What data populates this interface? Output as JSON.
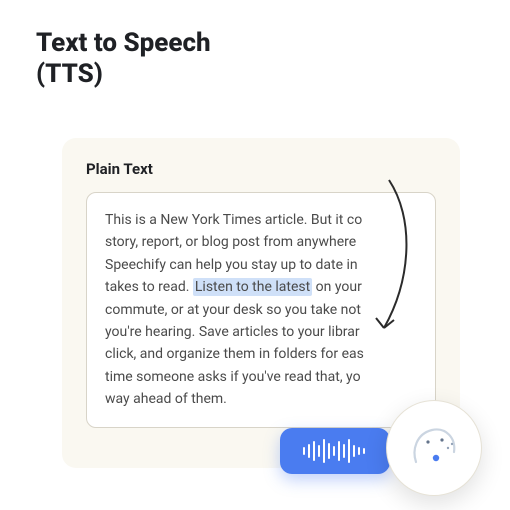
{
  "title_line1": "Text to Speech",
  "title_line2": "(TTS)",
  "card": {
    "label": "Plain Text",
    "body_before": "This is a New York Times article. But it co\nstory, report, or blog post from anywhere\nSpeechify can help you stay up to date in\ntakes to read. ",
    "highlight": "Listen to the latest",
    "body_after": " on your\ncommute, or at your desk so you take not\nyou're hearing. Save articles to your librar\nclick, and organize them in folders for eas\ntime someone asks if you've read that, yo\nway ahead of them."
  },
  "icons": {
    "audio": "waveform-icon",
    "avatar": "face-speaking-icon",
    "arrow": "curved-arrow-icon"
  },
  "colors": {
    "accent": "#4a7cf0",
    "highlight": "#cfe0f8",
    "card_bg": "#faf8f1"
  }
}
